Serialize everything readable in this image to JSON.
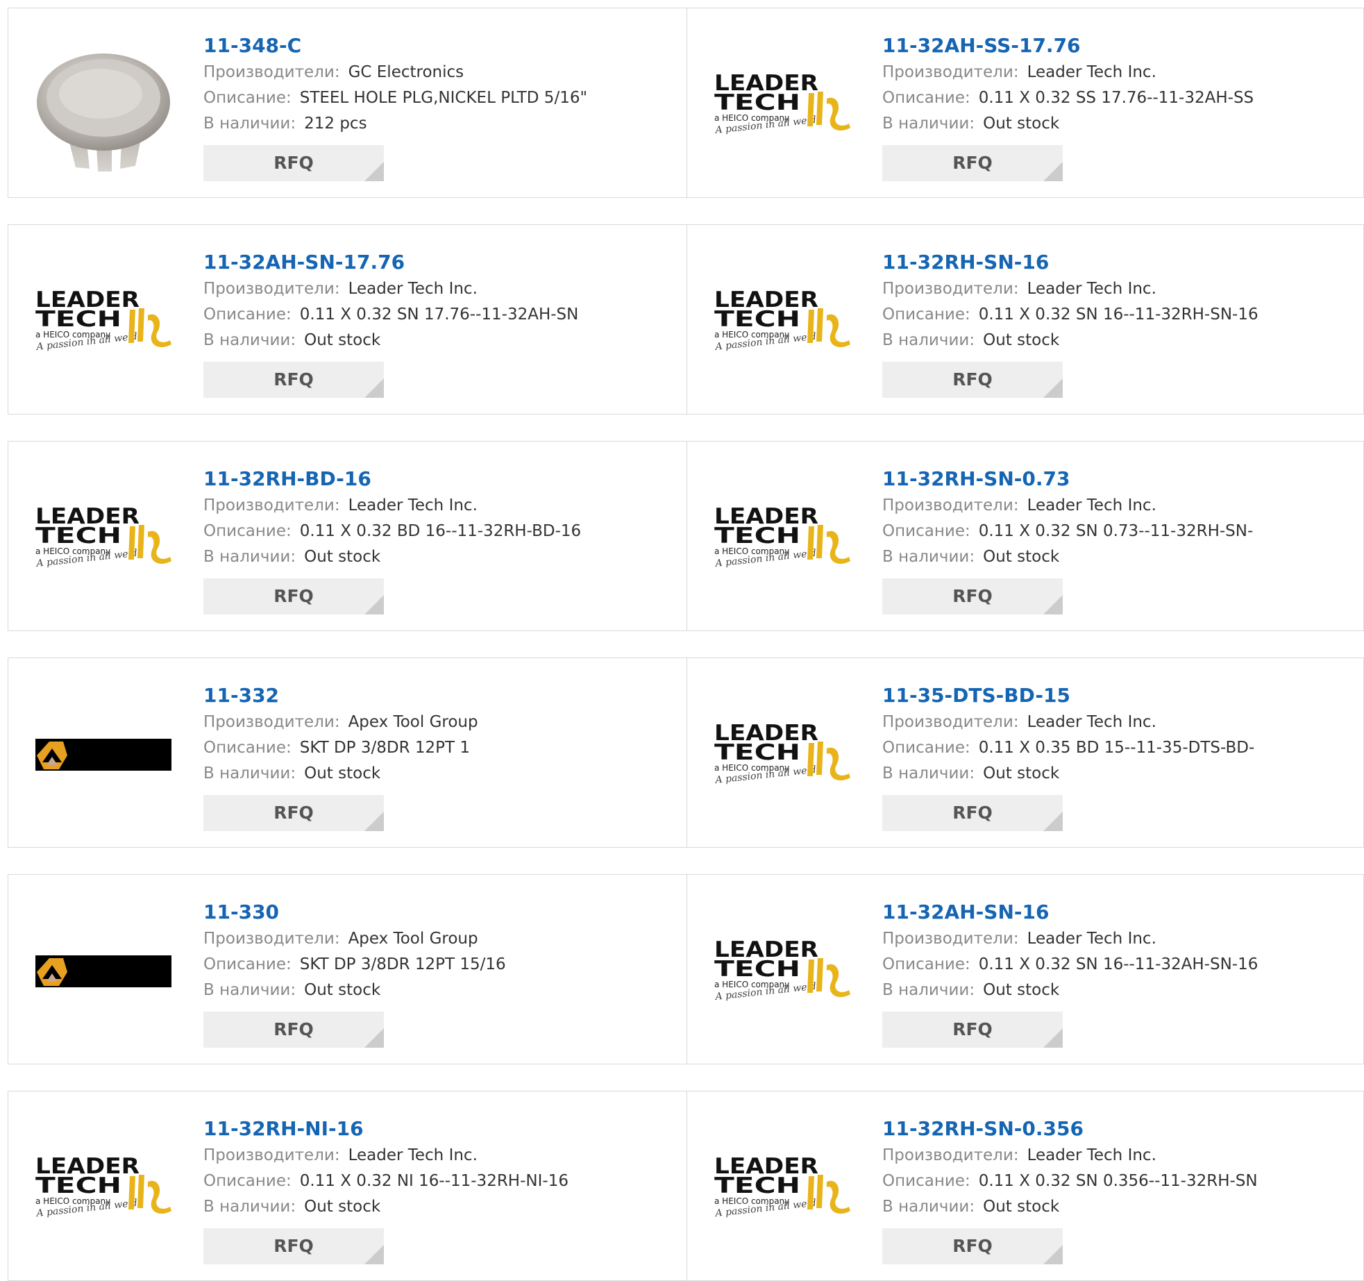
{
  "labels": {
    "manufacturer": "Производители:",
    "description": "Описание:",
    "stock": "В наличии:",
    "rfq": "RFQ"
  },
  "logos": {
    "leader_tech": {
      "line1": "LEADER",
      "line2": "TECH",
      "sub": "a HEICO company",
      "tagline": "A passion in all we do"
    }
  },
  "colors": {
    "part_link": "#1565b3",
    "label_gray": "#888888",
    "rfq_bg": "#eeeeee",
    "border": "#d9d9d9",
    "leader_yellow": "#e8b41a",
    "apex_orange": "#e8a020"
  },
  "products": [
    {
      "part": "11-348-C",
      "manufacturer": "GC Electronics",
      "description": "STEEL HOLE PLG,NICKEL PLTD 5/16\"",
      "stock": "212 pcs",
      "image": "hole-plug-photo"
    },
    {
      "part": "11-32AH-SS-17.76",
      "manufacturer": "Leader Tech Inc.",
      "description": "0.11 X 0.32 SS 17.76--11-32AH-SS",
      "stock": "Out stock",
      "image": "leader-tech-logo"
    },
    {
      "part": "11-32AH-SN-17.76",
      "manufacturer": "Leader Tech Inc.",
      "description": "0.11 X 0.32 SN 17.76--11-32AH-SN",
      "stock": "Out stock",
      "image": "leader-tech-logo"
    },
    {
      "part": "11-32RH-SN-16",
      "manufacturer": "Leader Tech Inc.",
      "description": "0.11 X 0.32 SN 16--11-32RH-SN-16",
      "stock": "Out stock",
      "image": "leader-tech-logo"
    },
    {
      "part": "11-32RH-BD-16",
      "manufacturer": "Leader Tech Inc.",
      "description": "0.11 X 0.32 BD 16--11-32RH-BD-16",
      "stock": "Out stock",
      "image": "leader-tech-logo"
    },
    {
      "part": "11-32RH-SN-0.73",
      "manufacturer": "Leader Tech Inc.",
      "description": "0.11 X 0.32 SN 0.73--11-32RH-SN-",
      "stock": "Out stock",
      "image": "leader-tech-logo"
    },
    {
      "part": "11-332",
      "manufacturer": "Apex Tool Group",
      "description": "SKT DP 3/8DR 12PT 1",
      "stock": "Out stock",
      "image": "apex-tool-logo"
    },
    {
      "part": "11-35-DTS-BD-15",
      "manufacturer": "Leader Tech Inc.",
      "description": "0.11 X 0.35 BD 15--11-35-DTS-BD-",
      "stock": "Out stock",
      "image": "leader-tech-logo"
    },
    {
      "part": "11-330",
      "manufacturer": "Apex Tool Group",
      "description": "SKT DP 3/8DR 12PT 15/16",
      "stock": "Out stock",
      "image": "apex-tool-logo"
    },
    {
      "part": "11-32AH-SN-16",
      "manufacturer": "Leader Tech Inc.",
      "description": "0.11 X 0.32 SN 16--11-32AH-SN-16",
      "stock": "Out stock",
      "image": "leader-tech-logo"
    },
    {
      "part": "11-32RH-NI-16",
      "manufacturer": "Leader Tech Inc.",
      "description": "0.11 X 0.32 NI 16--11-32RH-NI-16",
      "stock": "Out stock",
      "image": "leader-tech-logo"
    },
    {
      "part": "11-32RH-SN-0.356",
      "manufacturer": "Leader Tech Inc.",
      "description": "0.11 X 0.32 SN 0.356--11-32RH-SN",
      "stock": "Out stock",
      "image": "leader-tech-logo"
    }
  ]
}
